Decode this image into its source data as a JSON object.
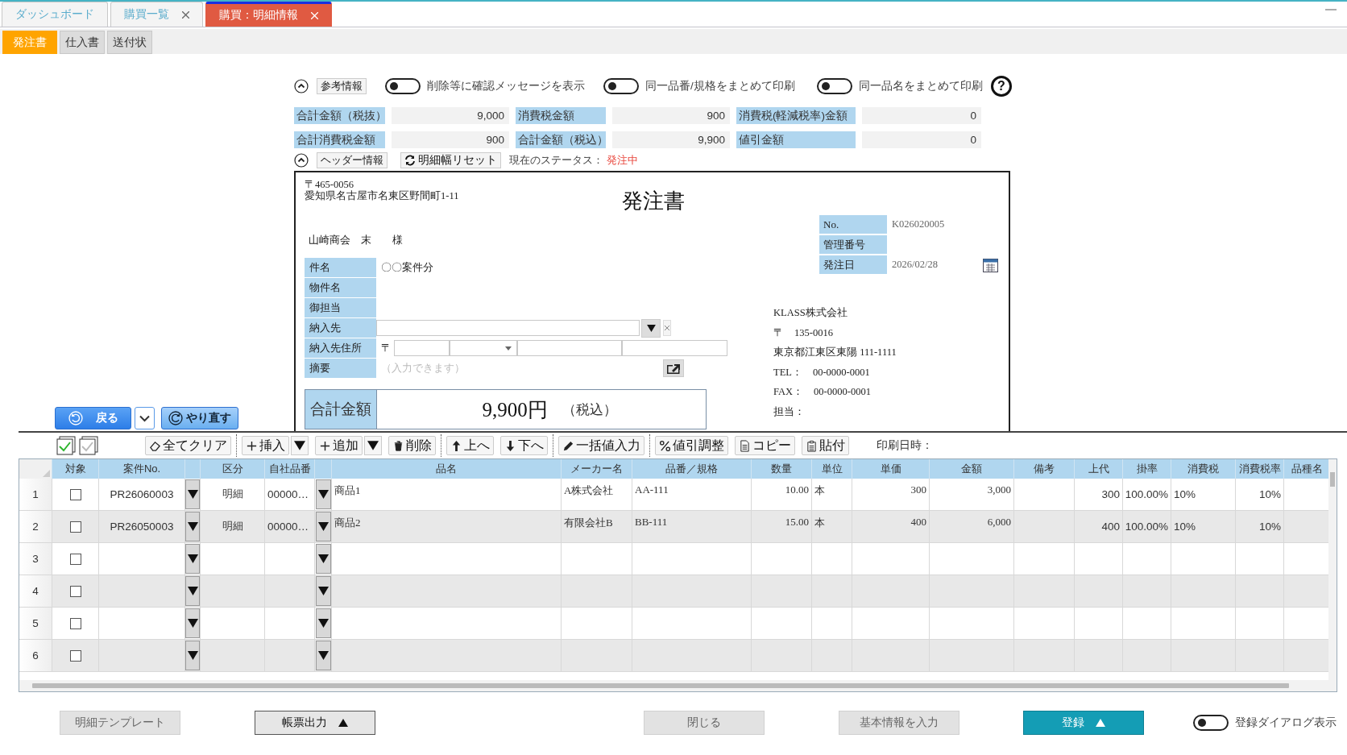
{
  "app_tabs": [
    {
      "label": "ダッシュボード",
      "closable": false,
      "selected": false
    },
    {
      "label": "購買一覧",
      "closable": true,
      "selected": false
    },
    {
      "label": "購買：明細情報",
      "closable": true,
      "selected": true
    }
  ],
  "doc_tabs": [
    {
      "label": "発注書",
      "selected": true
    },
    {
      "label": "仕入書",
      "selected": false
    },
    {
      "label": "送付状",
      "selected": false
    }
  ],
  "options": {
    "section_label": "参考情報",
    "expanded": true,
    "help": "?",
    "toggles": [
      {
        "label": "削除等に確認メッセージを表示",
        "on": false
      },
      {
        "label": "同一品番/規格をまとめて印刷",
        "on": false
      },
      {
        "label": "同一品名をまとめて印刷",
        "on": false
      }
    ]
  },
  "summary": [
    {
      "label": "合計金額（税抜）",
      "value": "9,000"
    },
    {
      "label": "消費税金額",
      "value": "900"
    },
    {
      "label": "消費税(軽減税率)金額",
      "value": "0"
    },
    {
      "label": "合計消費税金額",
      "value": "900"
    },
    {
      "label": "合計金額（税込）",
      "value": "9,900"
    },
    {
      "label": "値引金額",
      "value": "0"
    }
  ],
  "header_bar": {
    "section_label": "ヘッダー情報",
    "expanded": true,
    "reset_button": "明細幅リセット",
    "status_label": "現在のステータス：",
    "status": "発注中"
  },
  "document": {
    "sender_postal": "〒465-0056",
    "sender_address": "愛知県名古屋市名東区野間町1-11",
    "title": "発注書",
    "recipient": "山崎商会　末　　様",
    "fields": [
      {
        "label": "件名",
        "kind": "text",
        "value": "〇〇案件分"
      },
      {
        "label": "物件名",
        "kind": "text"
      },
      {
        "label": "御担当",
        "kind": "text"
      },
      {
        "label": "納入先",
        "kind": "combo"
      },
      {
        "label": "納入先住所",
        "kind": "address",
        "postal_mark": "〒"
      },
      {
        "label": "摘要",
        "kind": "memo",
        "placeholder": "（入力できます）"
      }
    ],
    "total": {
      "label": "合計金額",
      "amount": "9,900円",
      "note": "（税込）"
    },
    "meta": [
      {
        "label": "No.",
        "kind": "text",
        "value": "K026020005"
      },
      {
        "label": "管理番号",
        "kind": "text"
      },
      {
        "label": "発注日",
        "kind": "date",
        "value": "2026/02/28"
      }
    ],
    "company": [
      "KLASS株式会社",
      "〒　135-0016",
      "東京都江東区東陽 111-1111",
      "TEL：　00-0000-0001",
      "FAX：　00-0000-0001",
      "担当："
    ]
  },
  "nav": {
    "back": "戻る",
    "redo": "やり直す"
  },
  "toolbar": {
    "print_time_label": "印刷日時：",
    "buttons": [
      {
        "kind": "clear",
        "label": "全てクリア",
        "menu": false
      },
      {
        "kind": "insert",
        "label": "挿入",
        "menu": true
      },
      {
        "kind": "add",
        "label": "追加",
        "menu": true
      },
      {
        "kind": "delete",
        "label": "削除",
        "menu": false
      },
      {
        "kind": "up",
        "label": "上へ",
        "menu": false
      },
      {
        "kind": "down",
        "label": "下へ",
        "menu": false
      },
      {
        "kind": "bulk",
        "label": "一括値入力",
        "menu": false
      },
      {
        "kind": "discount",
        "label": "値引調整",
        "menu": false
      },
      {
        "kind": "copy",
        "label": "コピー",
        "menu": false
      },
      {
        "kind": "paste",
        "label": "貼付",
        "menu": false
      }
    ]
  },
  "table": {
    "columns": [
      {
        "kind": "check",
        "label": "対象"
      },
      {
        "kind": "text",
        "label": "案件No."
      },
      {
        "kind": "dropdown"
      },
      {
        "kind": "text",
        "label": "区分"
      },
      {
        "kind": "text",
        "label": "自社品番"
      },
      {
        "kind": "dropdown"
      },
      {
        "kind": "text",
        "label": "品名"
      },
      {
        "kind": "text",
        "label": "メーカー名"
      },
      {
        "kind": "text",
        "label": "品番／規格"
      },
      {
        "kind": "text",
        "label": "数量"
      },
      {
        "kind": "text",
        "label": "単位"
      },
      {
        "kind": "text",
        "label": "単価"
      },
      {
        "kind": "text",
        "label": "金額"
      },
      {
        "kind": "text",
        "label": "備考"
      },
      {
        "kind": "text",
        "label": "上代"
      },
      {
        "kind": "text",
        "label": "掛率"
      },
      {
        "kind": "text",
        "label": "消費税"
      },
      {
        "kind": "text",
        "label": "消費税率"
      },
      {
        "kind": "text",
        "label": "品種名"
      }
    ],
    "rows": [
      {
        "number": "1",
        "checked": false,
        "cells": [
          "PR26060003",
          "明細",
          "00000…",
          "商品1",
          "A株式会社",
          "AA-111",
          "10.00",
          "本",
          "300",
          "3,000",
          null,
          "300",
          "100.00%",
          "10%",
          "10%",
          null
        ]
      },
      {
        "number": "2",
        "checked": false,
        "cells": [
          "PR26050003",
          "明細",
          "00000…",
          "商品2",
          "有限会社B",
          "BB-111",
          "15.00",
          "本",
          "400",
          "6,000",
          null,
          "400",
          "100.00%",
          "10%",
          "10%",
          null
        ]
      },
      {
        "number": "3",
        "checked": false
      },
      {
        "number": "4",
        "checked": false
      },
      {
        "number": "5",
        "checked": false
      },
      {
        "number": "6",
        "checked": false
      }
    ]
  },
  "footer": {
    "buttons": [
      {
        "label": "明細テンプレート",
        "disabled": true,
        "menu": false
      },
      {
        "label": "帳票出力",
        "disabled": false,
        "menu": true
      },
      {
        "label": "閉じる",
        "disabled": true,
        "menu": false
      },
      {
        "label": "基本情報を入力",
        "disabled": true,
        "menu": false
      },
      {
        "label": "登録",
        "disabled": false,
        "menu": true
      }
    ],
    "toggle": {
      "label": "登録ダイアログ表示",
      "on": false
    }
  }
}
